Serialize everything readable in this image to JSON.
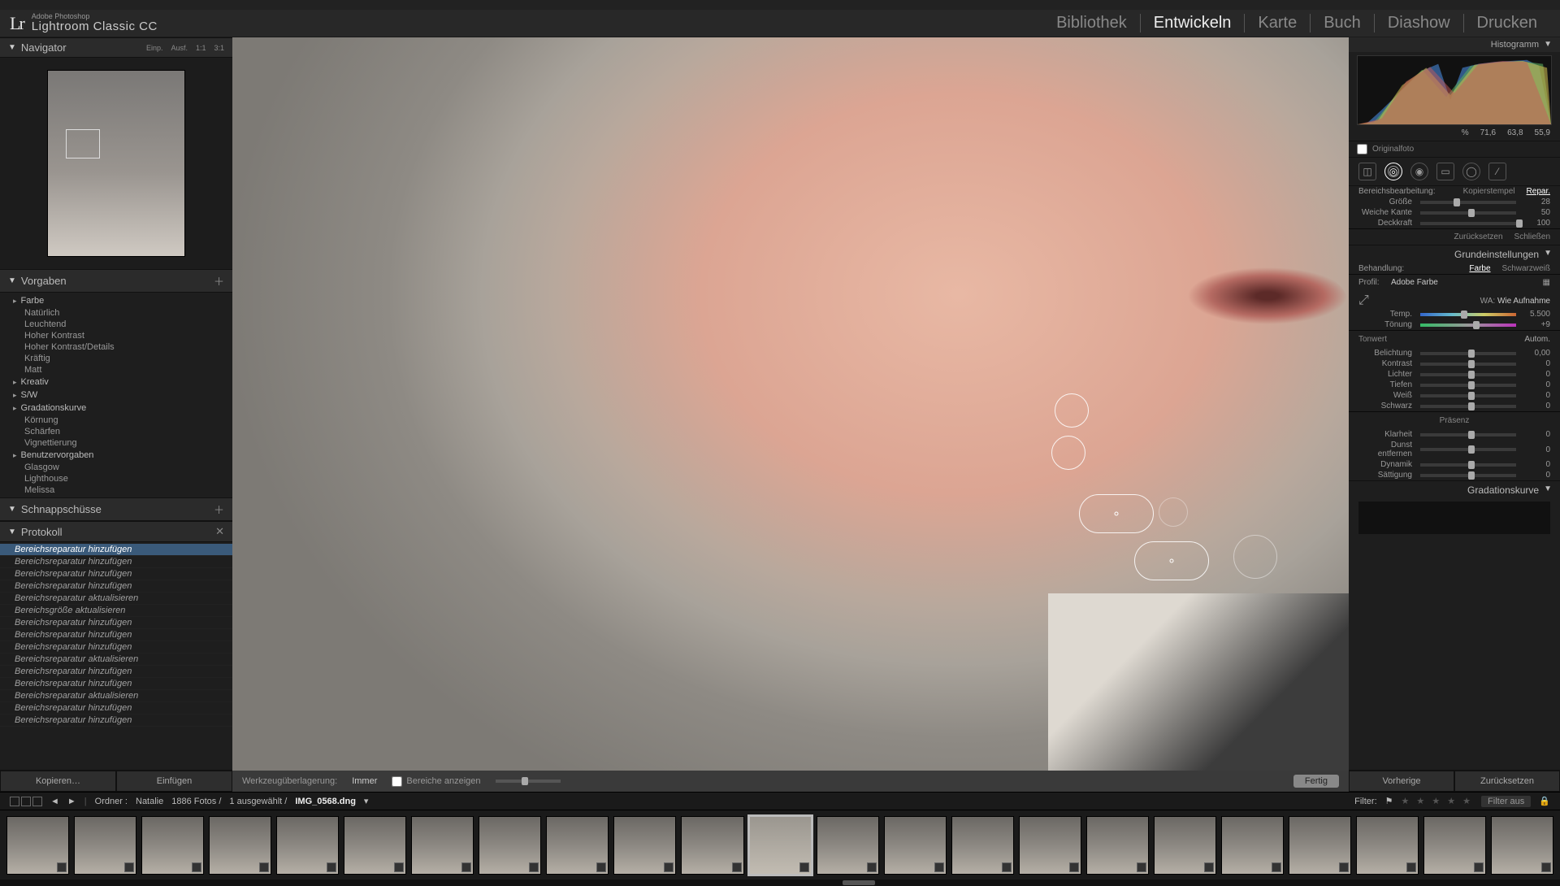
{
  "app": {
    "vendor": "Adobe Photoshop",
    "name": "Lightroom Classic CC"
  },
  "modules": [
    "Bibliothek",
    "Entwickeln",
    "Karte",
    "Buch",
    "Diashow",
    "Drucken"
  ],
  "active_module": 1,
  "left": {
    "navigator": {
      "title": "Navigator",
      "modes": [
        "Einp.",
        "Ausf.",
        "1:1",
        "3:1"
      ]
    },
    "presets": {
      "title": "Vorgaben",
      "groups": [
        {
          "name": "Farbe",
          "items": [
            "Natürlich",
            "Leuchtend",
            "Hoher Kontrast",
            "Hoher Kontrast/Details",
            "Kräftig",
            "Matt"
          ]
        },
        {
          "name": "Kreativ",
          "items": []
        },
        {
          "name": "S/W",
          "items": []
        },
        {
          "name": "Gradationskurve",
          "items": [
            "Körnung",
            "Schärfen",
            "Vignettierung"
          ]
        },
        {
          "name": "Benutzervorgaben",
          "items": [
            "Glasgow",
            "Lighthouse",
            "Melissa"
          ]
        }
      ]
    },
    "snapshots": {
      "title": "Schnappschüsse"
    },
    "protocol": {
      "title": "Protokoll",
      "items": [
        "Bereichsreparatur hinzufügen",
        "Bereichsreparatur hinzufügen",
        "Bereichsreparatur hinzufügen",
        "Bereichsreparatur hinzufügen",
        "Bereichsreparatur aktualisieren",
        "Bereichsgröße aktualisieren",
        "Bereichsreparatur hinzufügen",
        "Bereichsreparatur hinzufügen",
        "Bereichsreparatur hinzufügen",
        "Bereichsreparatur aktualisieren",
        "Bereichsreparatur hinzufügen",
        "Bereichsreparatur hinzufügen",
        "Bereichsreparatur aktualisieren",
        "Bereichsreparatur hinzufügen",
        "Bereichsreparatur hinzufügen"
      ],
      "selected_index": 0
    },
    "buttons": {
      "copy": "Kopieren…",
      "paste": "Einfügen"
    }
  },
  "center": {
    "overlay_label": "Werkzeugüberlagerung:",
    "overlay_value": "Immer",
    "show_areas": "Bereiche anzeigen",
    "done": "Fertig"
  },
  "right": {
    "histogram": {
      "title": "Histogramm",
      "vals": [
        "71,6",
        "63,8",
        "55,9"
      ],
      "pct": "%"
    },
    "original": "Originalfoto",
    "spot": {
      "title": "Bereichsbearbeitung:",
      "mode_a": "Kopierstempel",
      "mode_b": "Repar.",
      "rows": [
        {
          "lbl": "Größe",
          "val": "28",
          "pos": 35
        },
        {
          "lbl": "Weiche Kante",
          "val": "50",
          "pos": 50
        },
        {
          "lbl": "Deckkraft",
          "val": "100",
          "pos": 100
        }
      ],
      "reset": "Zurücksetzen",
      "close": "Schließen"
    },
    "basic": {
      "title": "Grundeinstellungen",
      "treat": "Behandlung:",
      "color": "Farbe",
      "bw": "Schwarzweiß",
      "profile_lbl": "Profil:",
      "profile": "Adobe Farbe",
      "wb_lbl": "WA:",
      "wb": "Wie Aufnahme",
      "rows": [
        {
          "lbl": "Temp.",
          "val": "5.500",
          "pos": 42,
          "cls": "hue"
        },
        {
          "lbl": "Tönung",
          "val": "+9",
          "pos": 55,
          "cls": "tint"
        }
      ],
      "tone_title": "Tonwert",
      "auto": "Autom.",
      "tone_rows": [
        {
          "lbl": "Belichtung",
          "val": "0,00",
          "pos": 50
        },
        {
          "lbl": "Kontrast",
          "val": "0",
          "pos": 50
        },
        {
          "lbl": "Lichter",
          "val": "0",
          "pos": 50
        },
        {
          "lbl": "Tiefen",
          "val": "0",
          "pos": 50
        },
        {
          "lbl": "Weiß",
          "val": "0",
          "pos": 50
        },
        {
          "lbl": "Schwarz",
          "val": "0",
          "pos": 50
        }
      ],
      "presence": "Präsenz",
      "presence_rows": [
        {
          "lbl": "Klarheit",
          "val": "0",
          "pos": 50
        },
        {
          "lbl": "Dunst entfernen",
          "val": "0",
          "pos": 50
        },
        {
          "lbl": "Dynamik",
          "val": "0",
          "pos": 50
        },
        {
          "lbl": "Sättigung",
          "val": "0",
          "pos": 50
        }
      ]
    },
    "curve_title": "Gradationskurve",
    "buttons": {
      "prev": "Vorherige",
      "reset": "Zurücksetzen"
    }
  },
  "info": {
    "folder_lbl": "Ordner : ",
    "folder": "Natalie",
    "count": "1886 Fotos /",
    "sel": "1 ausgewählt /",
    "file": "IMG_0568.dng",
    "filter_lbl": "Filter:",
    "filter_off": "Filter aus"
  },
  "filmstrip": {
    "count": 23,
    "selected": 11
  }
}
